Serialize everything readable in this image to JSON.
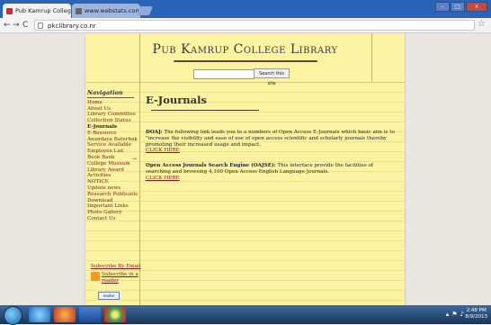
{
  "browser": {
    "tabs": [
      {
        "label": "Pub Kamrup College Library",
        "active": true
      },
      {
        "label": "www.webstats.com/page",
        "active": false
      }
    ],
    "url": "pkclibrary.co.nr"
  },
  "site": {
    "title": "Pub Kamrup College Library",
    "search_button": "Search this site"
  },
  "sidebar": {
    "heading": "Navigation",
    "items": [
      "Home",
      "About Us",
      "Library Committee",
      "Collection Status",
      "E-Journals",
      "E-Resource",
      "Anandaya Baterbakat",
      "Service Available",
      "Employee List",
      "Book Bank",
      "College Museum",
      "Library Award",
      "Activities",
      "NOTICE",
      "Update news",
      "Research Publications",
      "Download",
      "Important Links",
      "Photo Gallery",
      "Contact Us"
    ],
    "active_item": "E-Journals",
    "subscribe_email": "Subscribe By Email",
    "subscribe_reader_1": "Subscribe in a",
    "subscribe_reader_2": "reader",
    "badge": "reader"
  },
  "main": {
    "heading": "E-Journals",
    "doaj_label": "DOAJ:",
    "doaj_text": " The following link leads you to a numbers of Open Access E-Journals which basic aim is to \"increase the visibility and ease of use of open access scientific and scholarly journals thereby promoting their increased usage and impact.",
    "click_here_1": "CLICK HERE",
    "oajse_label": "Open Access Journals Search Engine (OAJSE):",
    "oajse_text": " This interface provide the facilities of searching and browsing 4,100 Open Access English Language Journals.",
    "click_here_2": "CLICK HERE"
  },
  "taskbar": {
    "time": "2:48 PM",
    "date": "8/9/2013"
  },
  "colors": {
    "paper": "#fbf3a2",
    "link": "#7a1a1a",
    "margin_line": "#e59a8a",
    "taskbar": "#1d3a5f"
  }
}
